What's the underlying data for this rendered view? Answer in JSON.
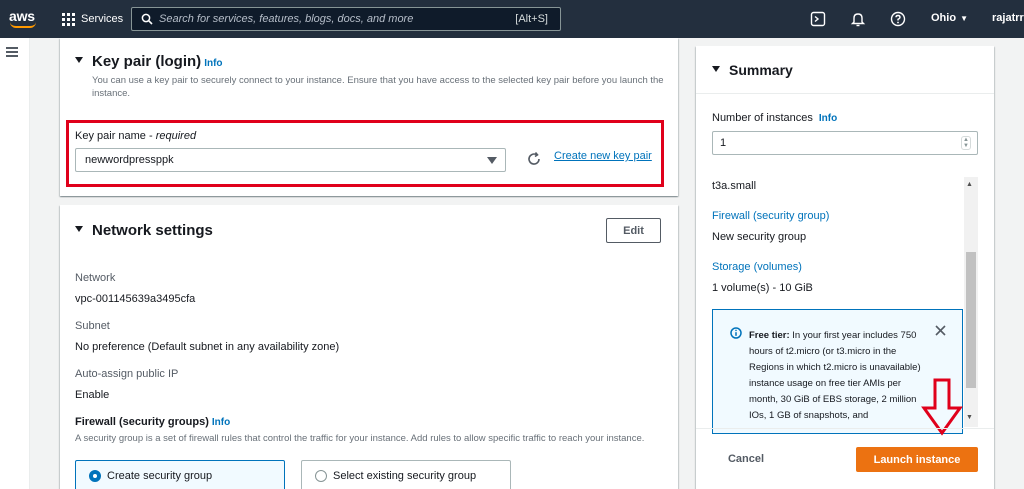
{
  "topnav": {
    "logo_text": "aws",
    "services_label": "Services",
    "search_placeholder": "Search for services, features, blogs, docs, and more",
    "search_shortcut": "[Alt+S]",
    "region": "Ohio",
    "account": "rajatrr",
    "icons": [
      "grid-icon",
      "search-icon",
      "cloudshell-icon",
      "bell-icon",
      "help-icon",
      "caret-down-icon"
    ]
  },
  "sidebar": {
    "icon": "hamburger-menu-icon"
  },
  "key_pair": {
    "title": "Key pair (login)",
    "info": "Info",
    "description": "You can use a key pair to securely connect to your instance. Ensure that you have access to the selected key pair before you launch the instance.",
    "field_label": "Key pair name - ",
    "field_label_required": "required",
    "selected": "newwordpressppk",
    "create_link": "Create new key pair",
    "highlight_color": "#e0001b"
  },
  "network": {
    "title": "Network settings",
    "edit_label": "Edit",
    "fields": [
      {
        "label": "Network",
        "value": "vpc-001145639a3495cfa"
      },
      {
        "label": "Subnet",
        "value": "No preference (Default subnet in any availability zone)"
      },
      {
        "label": "Auto-assign public IP",
        "value": "Enable"
      }
    ],
    "firewall_title": "Firewall (security groups)",
    "firewall_info": "Info",
    "firewall_desc": "A security group is a set of firewall rules that control the traffic for your instance. Add rules to allow specific traffic to reach your instance.",
    "options": [
      {
        "label": "Create security group",
        "selected": true
      },
      {
        "label": "Select existing security group",
        "selected": false
      }
    ]
  },
  "summary": {
    "title": "Summary",
    "instances_label": "Number of instances",
    "instances_info": "Info",
    "instances_value": "1",
    "instance_type": "t3a.small",
    "firewall_link": "Firewall (security group)",
    "firewall_value": "New security group",
    "storage_link": "Storage (volumes)",
    "storage_value": "1 volume(s) - 10 GiB",
    "free_tier_bold": "Free tier:",
    "free_tier_text": " In your first year includes 750 hours of t2.micro (or t3.micro in the Regions in which t2.micro is unavailable) instance usage on free tier AMIs per month, 30 GiB of EBS storage, 2 million IOs, 1 GB of snapshots, and",
    "cancel_label": "Cancel",
    "launch_label": "Launch instance",
    "accent_color": "#ec7211",
    "link_color": "#0073bb"
  }
}
